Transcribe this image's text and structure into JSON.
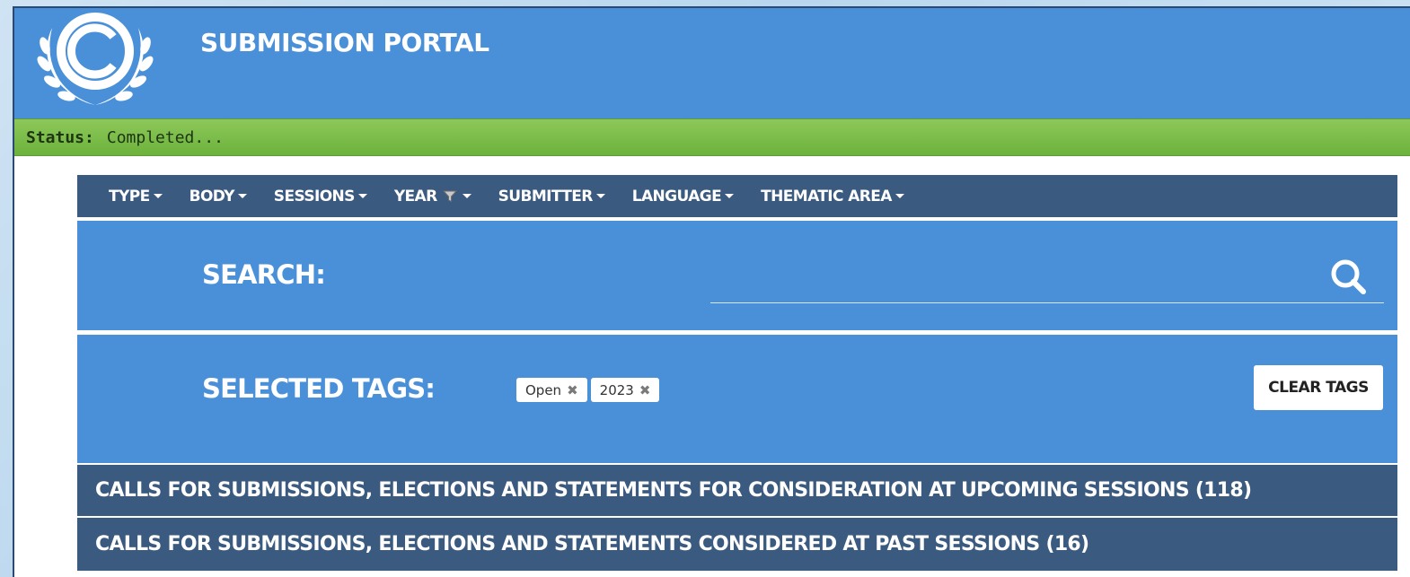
{
  "header": {
    "title": "SUBMISSION PORTAL",
    "logo_icon": "unfccc-emblem-icon"
  },
  "status": {
    "label": "Status:",
    "value": "Completed..."
  },
  "nav": {
    "items": [
      {
        "label": "TYPE",
        "filtered": false
      },
      {
        "label": "BODY",
        "filtered": false
      },
      {
        "label": "SESSIONS",
        "filtered": false
      },
      {
        "label": "YEAR",
        "filtered": true
      },
      {
        "label": "SUBMITTER",
        "filtered": false
      },
      {
        "label": "LANGUAGE",
        "filtered": false
      },
      {
        "label": "THEMATIC AREA",
        "filtered": false
      }
    ]
  },
  "search": {
    "label": "SEARCH:",
    "value": "",
    "placeholder": ""
  },
  "tags": {
    "label": "SELECTED TAGS:",
    "items": [
      "Open",
      "2023"
    ],
    "clear_label": "CLEAR TAGS"
  },
  "sections": [
    {
      "label": "CALLS FOR SUBMISSIONS, ELECTIONS AND STATEMENTS FOR CONSIDERATION AT UPCOMING SESSIONS (118)"
    },
    {
      "label": "CALLS FOR SUBMISSIONS, ELECTIONS AND STATEMENTS CONSIDERED AT PAST SESSIONS (16)"
    }
  ],
  "colors": {
    "header_blue": "#4a90d9",
    "nav_dark": "#3b5a7f",
    "status_green": "#7cbd4b"
  }
}
